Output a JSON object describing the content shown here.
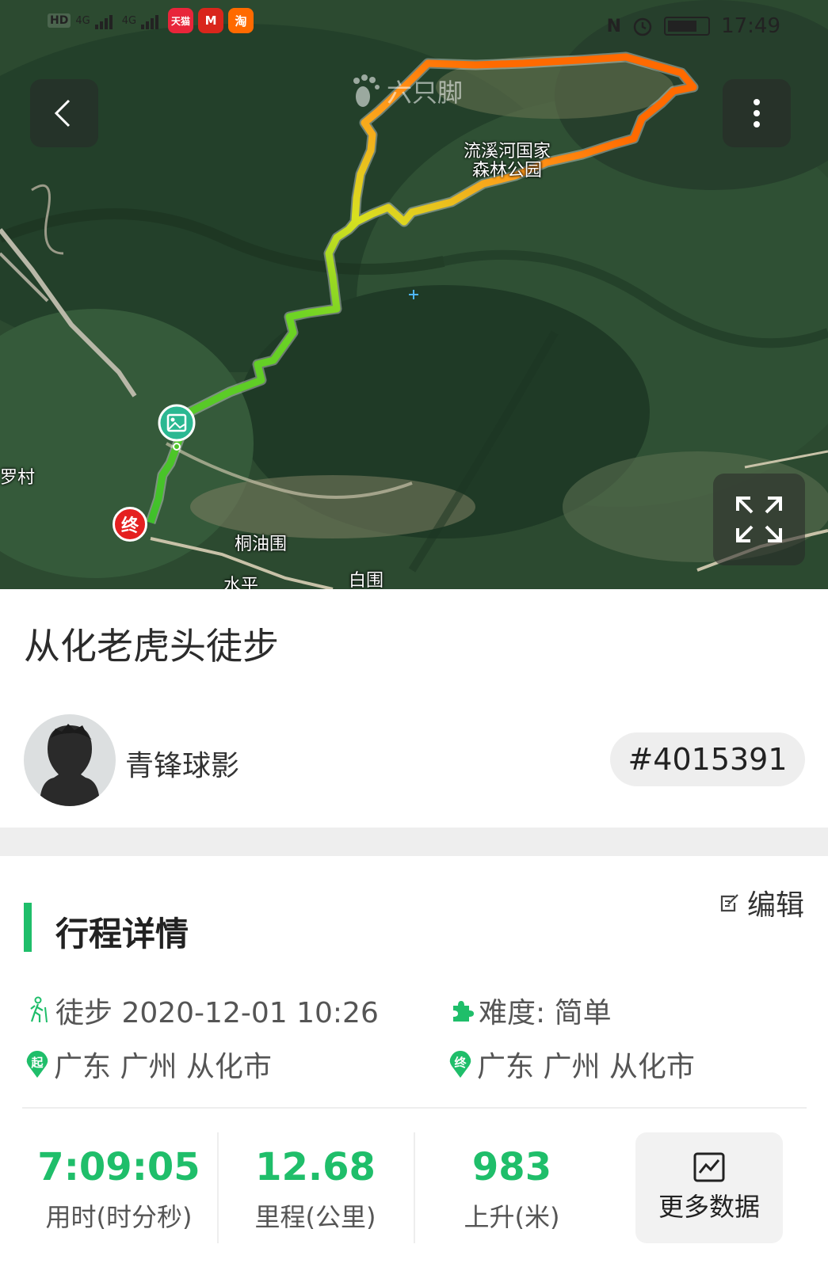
{
  "status_bar": {
    "hd1": "HD",
    "hd2": "HD",
    "net1": "4G",
    "net2": "4G",
    "apps": [
      {
        "name": "tmall-app-icon",
        "label": "天猫",
        "color": "#e8253a"
      },
      {
        "name": "mcdonalds-app-icon",
        "label": "M",
        "color": "#d9261c"
      },
      {
        "name": "taobao-app-icon",
        "label": "淘",
        "color": "#ff6a00"
      }
    ],
    "time": "17:49"
  },
  "map": {
    "watermark": "六只脚",
    "labels": {
      "park_line1": "流溪河国家",
      "park_line2": "森林公园",
      "village1": "罗村",
      "village2": "桐油围",
      "village3": "水平",
      "village4": "白围"
    },
    "end_marker": "终",
    "route_colors": {
      "start": "#5bd22c",
      "mid": "#c8ea20",
      "peak": "#ff6a00"
    }
  },
  "trip": {
    "title": "从化老虎头徒步",
    "user": {
      "name": "青锋球影"
    },
    "id": "#4015391"
  },
  "details": {
    "section_title": "行程详情",
    "edit_label": "编辑",
    "activity": "徒步 2020-12-01 10:26",
    "difficulty": "难度: 简单",
    "start_badge": "起",
    "start_location": "广东 广州 从化市",
    "end_badge": "终",
    "end_location": "广东 广州 从化市"
  },
  "stats": [
    {
      "value": "7:09:05",
      "label": "用时(时分秒)"
    },
    {
      "value": "12.68",
      "label": "里程(公里)"
    },
    {
      "value": "983",
      "label": "上升(米)"
    }
  ],
  "more_data_label": "更多数据",
  "accent_color": "#1fbe6a"
}
